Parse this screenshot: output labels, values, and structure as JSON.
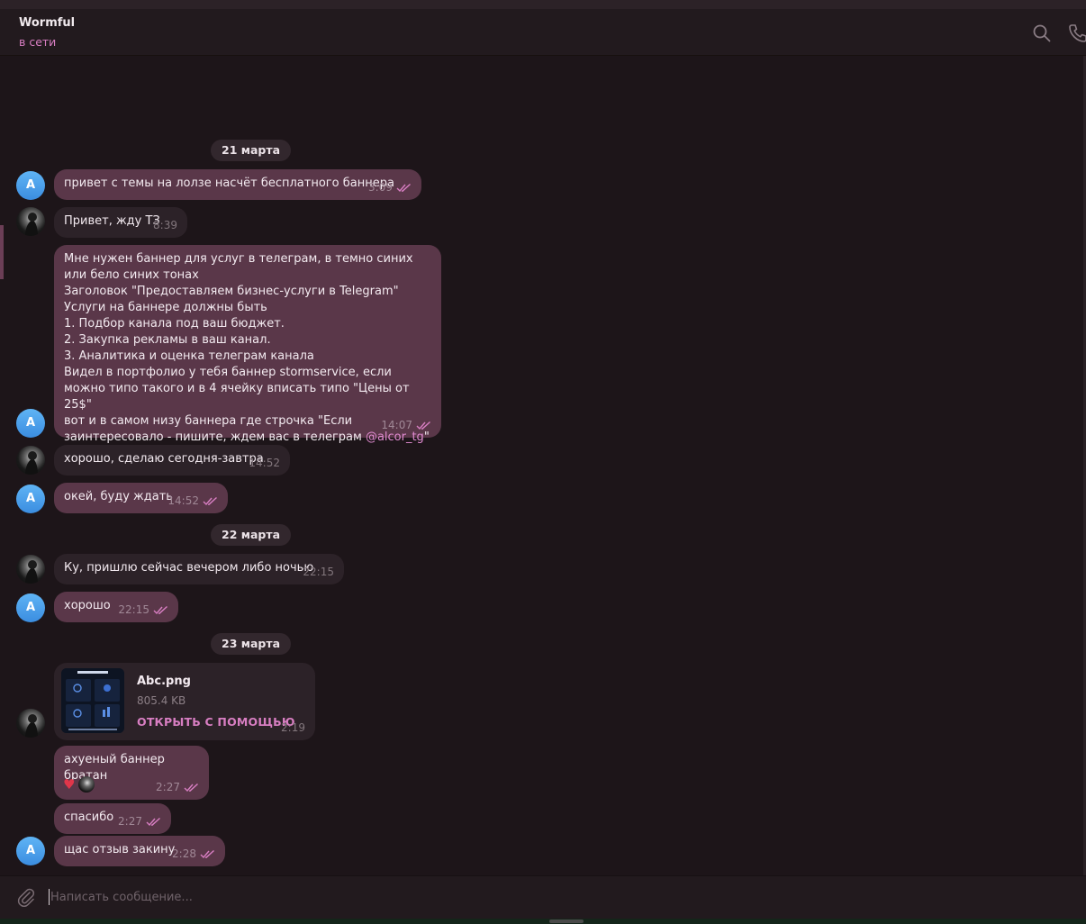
{
  "header": {
    "title": "Wormful",
    "status": "в сети",
    "icons": [
      "search-icon",
      "phone-icon"
    ]
  },
  "dates": [
    "21 марта",
    "22 марта",
    "23 марта"
  ],
  "avatars": {
    "self_letter": "A"
  },
  "messages": [
    {
      "text": "привет с темы на лолзе насчёт бесплатного баннера",
      "time": "3:09"
    },
    {
      "text": "Привет, жду ТЗ",
      "time": "8:39"
    },
    {
      "text_main": "Мне нужен баннер для услуг в телеграм, в темно синих или бело синих тонах\nЗаголовок \"Предоставляем бизнес-услуги в Telegram\"\nУслуги на баннере должны быть\n1. Подбор канала под ваш бюджет.\n2. Закупка рекламы в ваш канал.\n3. Аналитика и оценка телеграм канала\nВидел в портфолио у тебя баннер stormservice, если можно типо такого и в 4 ячейку вписать типо \"Цены от 25$\"\nвот и в самом низу баннера где строчка \"Если заинтересовало - пишите, ждем вас в телеграм ",
      "mention": "@alcor_tg",
      "text_tail": "\"",
      "time": "14:07"
    },
    {
      "text": "хорошо, сделаю сегодня-завтра",
      "time": "14:52"
    },
    {
      "text": "окей, буду ждать",
      "time": "14:52"
    },
    {
      "text": "Ку, пришлю сейчас вечером либо ночью",
      "time": "22:15"
    },
    {
      "text": "хорошо",
      "time": "22:15"
    },
    {
      "file_name": "Abc.png",
      "file_size": "805.4 KB",
      "open_label": "ОТКРЫТЬ С ПОМОЩЬЮ",
      "time": "2:19"
    },
    {
      "text": "ахуеный баннер братан",
      "time": "2:27",
      "reaction": "heart"
    },
    {
      "text": "спасибо",
      "time": "2:27"
    },
    {
      "text": "щас отзыв закину",
      "time": "2:28"
    }
  ],
  "composer": {
    "placeholder": "Написать сообщение..."
  },
  "colors": {
    "background": "#1d1519",
    "outgoing_bubble": "#5a3749",
    "incoming_bubble": "#2c2228",
    "accent": "#d87ec2"
  }
}
